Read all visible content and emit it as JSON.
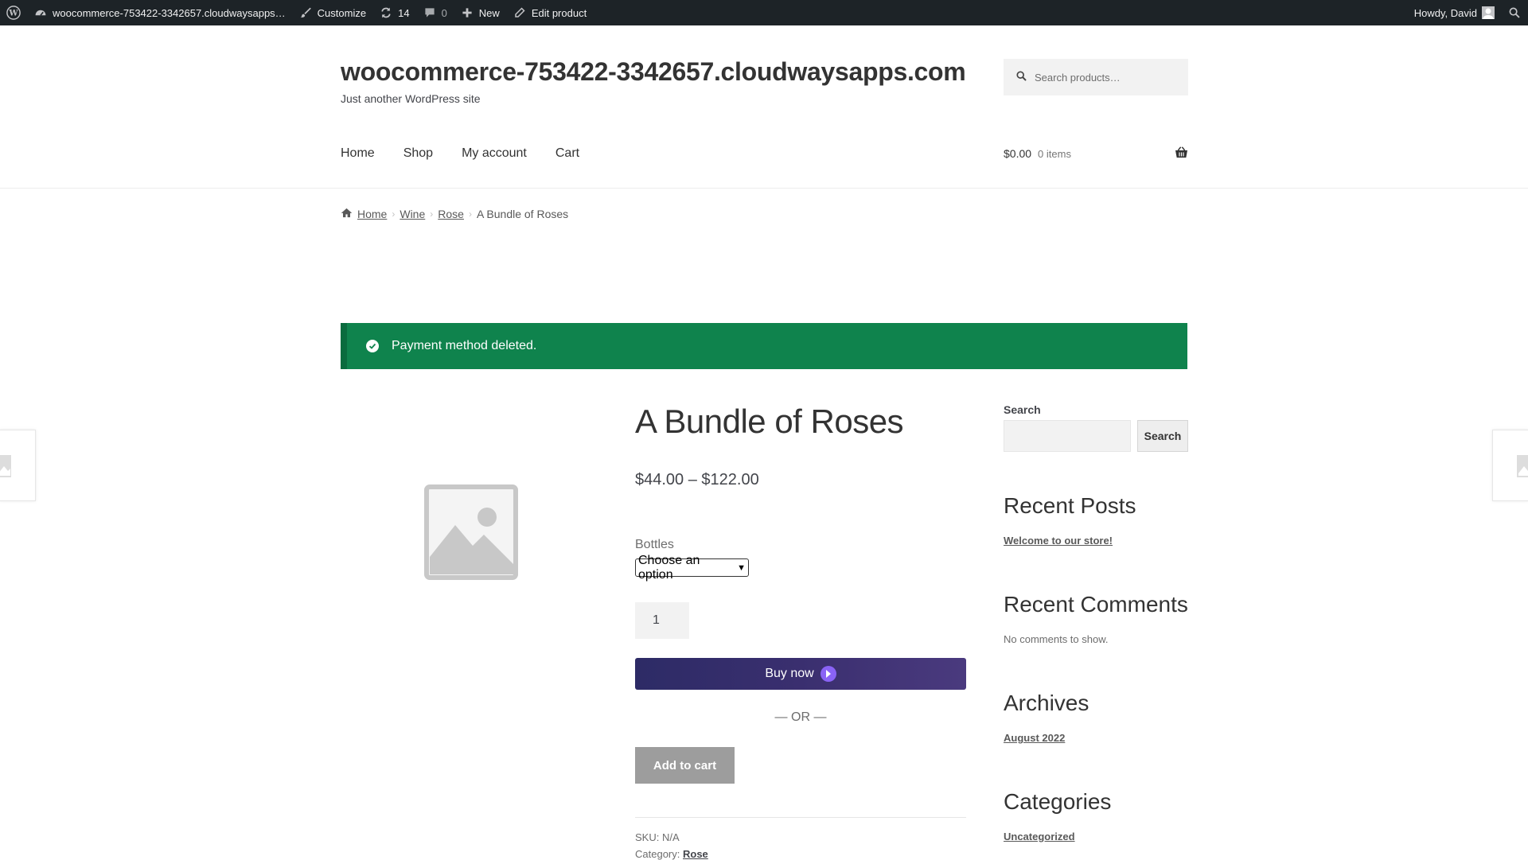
{
  "admin_bar": {
    "site_name": "woocommerce-753422-3342657.cloudwaysapps…",
    "customize": "Customize",
    "updates_count": "14",
    "comments_count": "0",
    "new": "New",
    "edit_product": "Edit product",
    "howdy": "Howdy, David"
  },
  "header": {
    "site_title": "woocommerce-753422-3342657.cloudwaysapps.com",
    "tagline": "Just another WordPress site",
    "search_placeholder": "Search products…",
    "nav": [
      "Home",
      "Shop",
      "My account",
      "Cart"
    ],
    "cart_total": "$0.00",
    "cart_items": "0 items"
  },
  "breadcrumb": [
    "Home",
    "Wine",
    "Rose",
    "A Bundle of Roses"
  ],
  "notice": "Payment method deleted.",
  "product": {
    "title": "A Bundle of Roses",
    "price": "$44.00 – $122.00",
    "variation_label": "Bottles",
    "variation_selected": "Choose an option",
    "quantity": "1",
    "buy_now": "Buy now",
    "or": "— OR —",
    "add_to_cart": "Add to cart",
    "sku_label": "SKU:",
    "sku_value": "N/A",
    "category_label": "Category:",
    "category_value": "Rose"
  },
  "sidebar": {
    "search_label": "Search",
    "search_button": "Search",
    "recent_posts_title": "Recent Posts",
    "recent_post": "Welcome to our store!",
    "recent_comments_title": "Recent Comments",
    "no_comments": "No comments to show.",
    "archives_title": "Archives",
    "archive_item": "August 2022",
    "categories_title": "Categories",
    "category_item": "Uncategorized"
  },
  "colors": {
    "admin_bar": "#1d2327",
    "notice_green": "#0f834d",
    "buy_now_purple": "#3a2f6f",
    "add_to_cart_gray": "#9d9d9d"
  }
}
